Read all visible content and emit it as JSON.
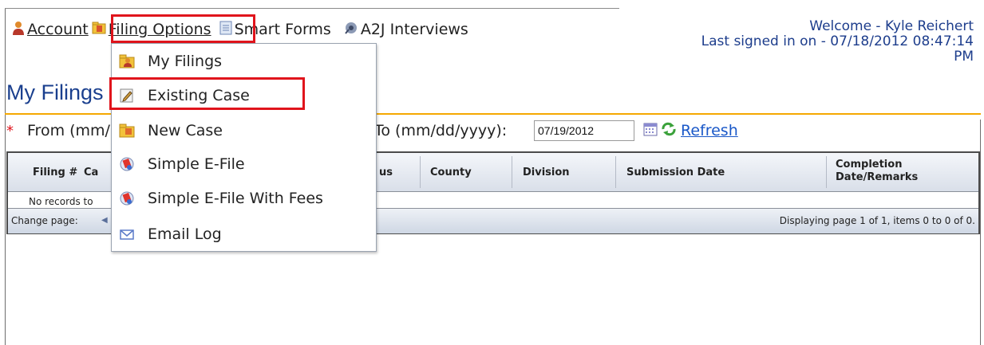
{
  "nav": {
    "account": "Account",
    "filing_options": "Filing Options",
    "smart_forms": "Smart Forms",
    "a2j_interviews": "A2J Interviews"
  },
  "welcome": {
    "line1": "Welcome - Kyle Reichert",
    "line2": "Last signed in on - 07/18/2012 08:47:14",
    "line3": "PM"
  },
  "page": {
    "title": "My Filings"
  },
  "dates": {
    "from_label": "From (mm/dd/yyyy):",
    "to_label": "To (mm/dd/yyyy):",
    "to_value": "07/19/2012",
    "refresh": "Refresh"
  },
  "grid": {
    "columns": [
      "Filing #",
      "Ca",
      "us",
      "County",
      "Division",
      "Submission Date",
      "Completion Date/Remarks"
    ],
    "empty_text": "No records to",
    "pager_left": "Change page:",
    "pager_right": "Displaying page 1 of 1, items 0 to 0 of 0."
  },
  "dropdown": {
    "items": [
      {
        "label": "My Filings",
        "icon": "my-filings-icon"
      },
      {
        "label": "Existing Case",
        "icon": "edit-icon"
      },
      {
        "label": "New Case",
        "icon": "folder-icon"
      },
      {
        "label": "Simple E-File",
        "icon": "efile-icon"
      },
      {
        "label": "Simple E-File With Fees",
        "icon": "efile-fees-icon"
      },
      {
        "label": "Email Log",
        "icon": "email-icon"
      }
    ]
  },
  "colors": {
    "highlight": "#e0141c",
    "title_blue": "#1a3f8e",
    "link_blue": "#1a58c8",
    "orange_rule": "#f5a800"
  }
}
